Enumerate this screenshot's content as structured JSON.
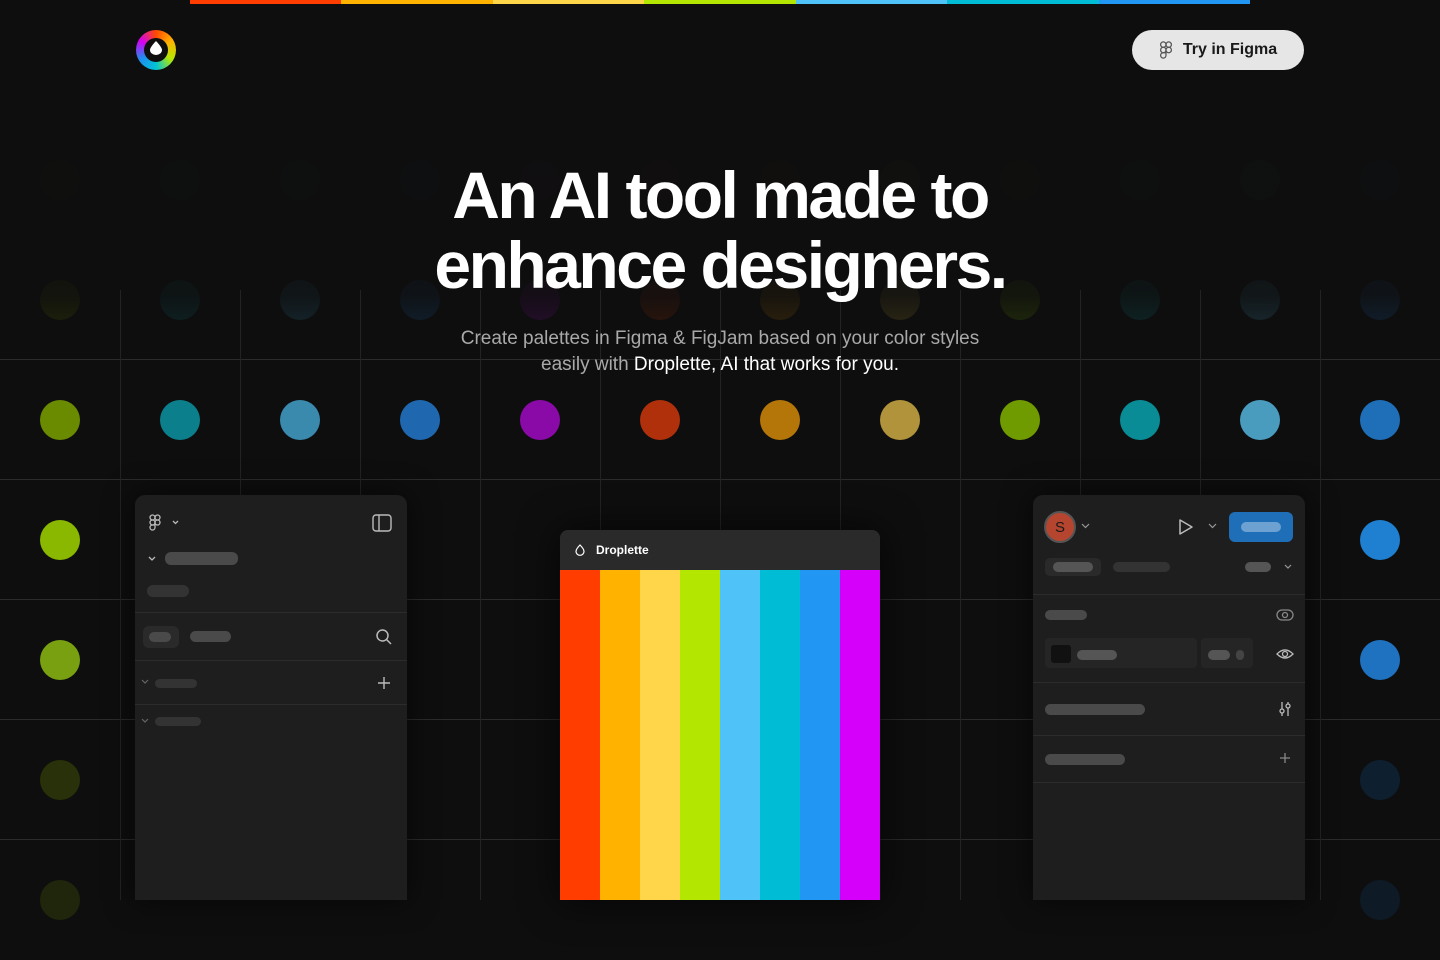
{
  "brand_colors": [
    "#ff3d00",
    "#ffb300",
    "#ffd54a",
    "#b3e600",
    "#4fc3f7",
    "#00bcd4",
    "#2196f3",
    "#d500f9"
  ],
  "header": {
    "try_button_label": "Try in Figma",
    "logo_icon": "droplette-logo-icon"
  },
  "hero": {
    "title_line1": "An AI tool made to",
    "title_line2": "enhance designers.",
    "subtitle_part1": "Create palettes in Figma & FigJam based on your color styles",
    "subtitle_part2": "easily with ",
    "subtitle_strong": "Droplette, AI that works for you."
  },
  "plugin": {
    "title": "Droplette",
    "stripe_colors": [
      "#ff3d00",
      "#ffb300",
      "#ffd54a",
      "#b3e600",
      "#4fc3f7",
      "#00bcd4",
      "#2196f3",
      "#d500f9"
    ]
  },
  "right_panel": {
    "avatar_initial": "S",
    "avatar_color": "#b5452f",
    "share_color": "#1f6fb8"
  },
  "background_dots": [
    [
      "#5a6b00",
      "#0e6a72",
      "#2f7fa0",
      "#1a5fa0",
      "#7a0f9a",
      "#a0300a",
      "#a36a06",
      "#a08a30",
      "#5f8c00",
      "#0b7a82",
      "#3f8fb0",
      "#1d5fa3"
    ],
    [
      "#6a8a00",
      "#0b7f8c",
      "#3a8aae",
      "#1f68b0",
      "#8a0aa8",
      "#b0300c",
      "#b47608",
      "#b0933a",
      "#6f9a00",
      "#0a8c96",
      "#4a9cbe",
      "#1f6fb8"
    ],
    [
      "#8ab800",
      "",
      "",
      "",
      "",
      "",
      "",
      "",
      "",
      "",
      "",
      "#1f7fd0"
    ],
    [
      "#78a010",
      "",
      "",
      "",
      "",
      "",
      "",
      "",
      "",
      "",
      "",
      "#1f72c0"
    ],
    [
      "#3a4a08",
      "",
      "",
      "",
      "",
      "",
      "",
      "",
      "",
      "",
      "",
      "#0f2c48"
    ]
  ]
}
